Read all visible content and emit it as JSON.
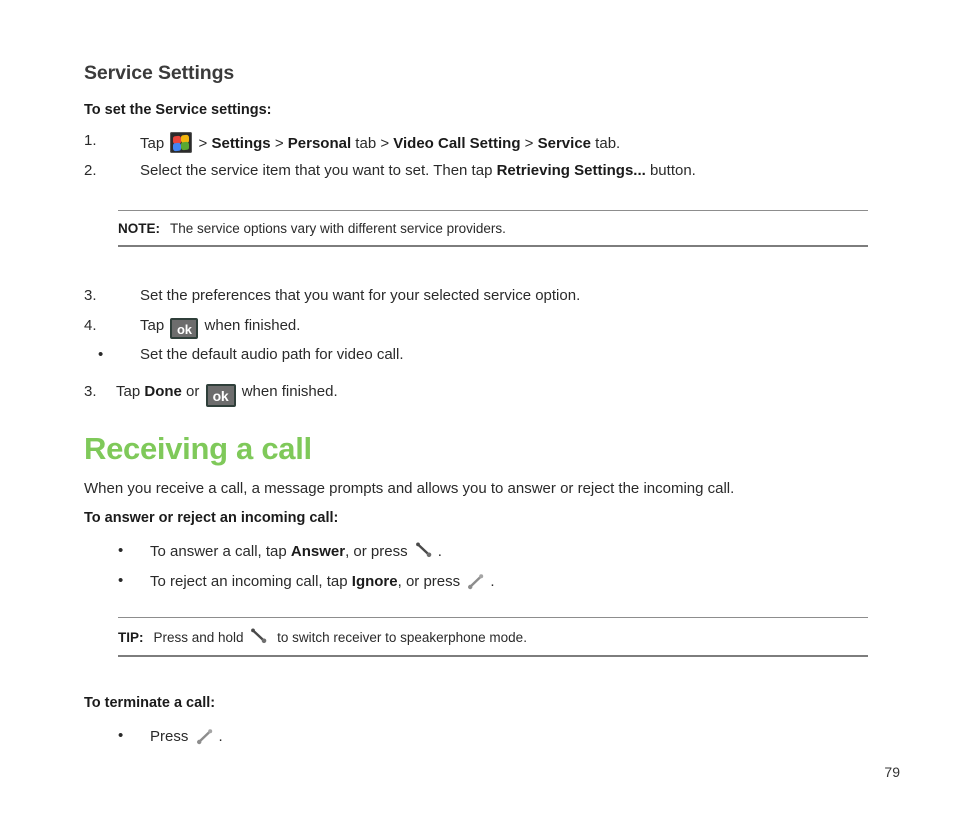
{
  "page": {
    "number": "79",
    "accent_green": "#7fc95a",
    "text_color": "#2a2a2a"
  },
  "service_settings": {
    "heading": "Service Settings",
    "lead": "To set the Service settings:",
    "steps": [
      {
        "number": "1.",
        "pre": "Tap ",
        "icon": "windows-start-icon",
        "parts": [
          {
            "text": " > ",
            "bold": false
          },
          {
            "text": "Settings",
            "bold": true
          },
          {
            "text": " > ",
            "bold": false
          },
          {
            "text": "Personal",
            "bold": true
          },
          {
            "text": " tab > ",
            "bold": false
          },
          {
            "text": "Video Call Setting",
            "bold": true
          },
          {
            "text": " > ",
            "bold": false
          },
          {
            "text": "Service",
            "bold": true
          },
          {
            "text": " tab.",
            "bold": false
          }
        ]
      },
      {
        "number": "2.",
        "parts": [
          {
            "text": "Select the service item that you want to set. Then tap ",
            "bold": false
          },
          {
            "text": "Retrieving Settings...",
            "bold": true
          },
          {
            "text": " button.",
            "bold": false
          }
        ]
      }
    ],
    "note": {
      "tag": "NOTE:",
      "text": "The service options vary with different service providers."
    },
    "steps_after_note": [
      {
        "number": "3.",
        "parts": [
          {
            "text": "Set the preferences that you want for your selected service option.",
            "bold": false
          }
        ]
      },
      {
        "number": "4.",
        "pre": "Tap ",
        "icon": "ok-button-icon",
        "post": " when finished."
      }
    ],
    "bullet_audio": "Set the default audio path for video call.",
    "step_done": {
      "number": "3.",
      "pre": "Tap ",
      "bold_word": "Done",
      "mid": " or ",
      "icon": "ok-button-icon",
      "post": " when finished."
    }
  },
  "receiving_call": {
    "heading": "Receiving a call",
    "intro": "When you receive a call, a message prompts and allows you to answer or reject the incoming call.",
    "lead": "To answer or reject an incoming call:",
    "bullets": [
      {
        "pre": "To answer a call, tap ",
        "bold_word": "Answer",
        "mid": ", or press ",
        "icon": "phone-answer-icon",
        "post": "."
      },
      {
        "pre": "To reject an incoming call, tap ",
        "bold_word": "Ignore",
        "mid": ", or press ",
        "icon": "phone-end-icon",
        "post": "."
      }
    ],
    "tip": {
      "tag": "TIP:",
      "pre": "Press and hold ",
      "icon": "phone-answer-icon",
      "post": " to switch receiver to speakerphone mode."
    },
    "terminate": {
      "lead": "To terminate a call:",
      "bullet": {
        "pre": "Press ",
        "icon": "phone-end-icon",
        "post": "."
      }
    }
  }
}
